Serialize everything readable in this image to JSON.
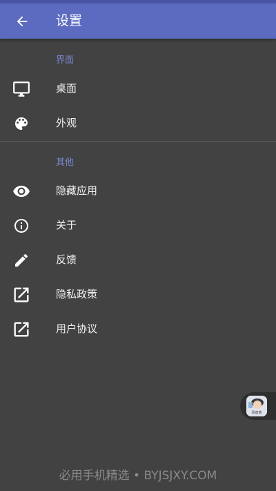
{
  "toolbar": {
    "title": "设置",
    "back_icon": "arrow-back-icon",
    "background": "#5c6bc0"
  },
  "sections": [
    {
      "header": "界面",
      "items": [
        {
          "label": "桌面",
          "icon": "monitor-icon"
        },
        {
          "label": "外观",
          "icon": "palette-icon"
        }
      ]
    },
    {
      "header": "其他",
      "items": [
        {
          "label": "隐藏应用",
          "icon": "eye-icon"
        },
        {
          "label": "关于",
          "icon": "info-icon"
        },
        {
          "label": "反馈",
          "icon": "pencil-icon"
        },
        {
          "label": "隐私政策",
          "icon": "open-in-new-icon"
        },
        {
          "label": "用户协议",
          "icon": "open-in-new-icon"
        }
      ]
    }
  ],
  "floating_widget": {
    "thumb_text": "青皮桔"
  },
  "watermark": "必用手机精选 • BYJSJXY.COM",
  "colors": {
    "background": "#424242",
    "accent": "#7986cb",
    "text": "#f2f2f2"
  }
}
